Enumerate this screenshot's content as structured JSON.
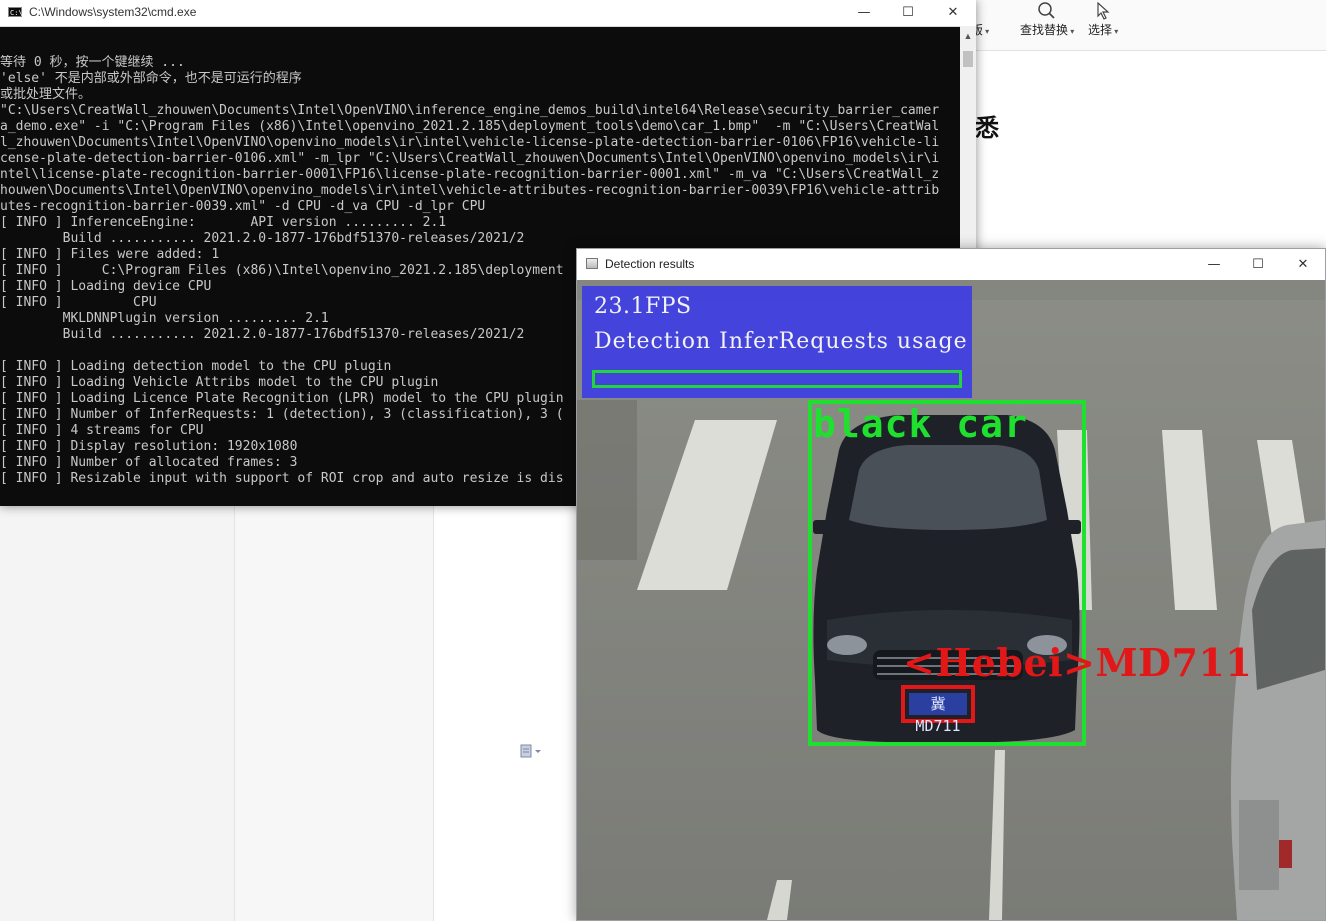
{
  "background_doc": {
    "ribbon": [
      {
        "label": "版",
        "icon": "layout-icon"
      },
      {
        "label": "查找替换",
        "icon": "search-icon"
      },
      {
        "label": "选择",
        "icon": "cursor-icon"
      }
    ],
    "heading_fragment": "悉"
  },
  "cmd": {
    "title": "C:\\Windows\\system32\\cmd.exe",
    "lines": [
      "等待 0 秒，按一个键继续 ...",
      "'else' 不是内部或外部命令，也不是可运行的程序",
      "或批处理文件。",
      "\"C:\\Users\\CreatWall_zhouwen\\Documents\\Intel\\OpenVINO\\inference_engine_demos_build\\intel64\\Release\\security_barrier_camer",
      "a_demo.exe\" -i \"C:\\Program Files (x86)\\Intel\\openvino_2021.2.185\\deployment_tools\\demo\\car_1.bmp\"  -m \"C:\\Users\\CreatWal",
      "l_zhouwen\\Documents\\Intel\\OpenVINO\\openvino_models\\ir\\intel\\vehicle-license-plate-detection-barrier-0106\\FP16\\vehicle-li",
      "cense-plate-detection-barrier-0106.xml\" -m_lpr \"C:\\Users\\CreatWall_zhouwen\\Documents\\Intel\\OpenVINO\\openvino_models\\ir\\i",
      "ntel\\license-plate-recognition-barrier-0001\\FP16\\license-plate-recognition-barrier-0001.xml\" -m_va \"C:\\Users\\CreatWall_z",
      "houwen\\Documents\\Intel\\OpenVINO\\openvino_models\\ir\\intel\\vehicle-attributes-recognition-barrier-0039\\FP16\\vehicle-attrib",
      "utes-recognition-barrier-0039.xml\" -d CPU -d_va CPU -d_lpr CPU",
      "[ INFO ] InferenceEngine:       API version ......... 2.1",
      "        Build ........... 2021.2.0-1877-176bdf51370-releases/2021/2",
      "[ INFO ] Files were added: 1",
      "[ INFO ]     C:\\Program Files (x86)\\Intel\\openvino_2021.2.185\\deployment",
      "[ INFO ] Loading device CPU",
      "[ INFO ]         CPU",
      "        MKLDNNPlugin version ......... 2.1",
      "        Build ........... 2021.2.0-1877-176bdf51370-releases/2021/2",
      "",
      "[ INFO ] Loading detection model to the CPU plugin",
      "[ INFO ] Loading Vehicle Attribs model to the CPU plugin",
      "[ INFO ] Loading Licence Plate Recognition (LPR) model to the CPU plugin",
      "[ INFO ] Number of InferRequests: 1 (detection), 3 (classification), 3 (",
      "[ INFO ] 4 streams for CPU",
      "[ INFO ] Display resolution: 1920x1080",
      "[ INFO ] Number of allocated frames: 3",
      "[ INFO ] Resizable input with support of ROI crop and auto resize is dis"
    ]
  },
  "detection": {
    "title": "Detection results",
    "fps": "23.1FPS",
    "usage_label": "Detection InferRequests usage",
    "usage_fraction": 0.0,
    "vehicle_label": "black car",
    "plate_label": "<Hebei>MD711",
    "plate_text": "冀 MD711"
  },
  "window_controls": {
    "minimize": "—",
    "maximize": "☐",
    "close": "✕"
  },
  "colors": {
    "detection_box": "#1fe02f",
    "plate_box": "#e21717",
    "fps_panel": "#3737eb"
  }
}
